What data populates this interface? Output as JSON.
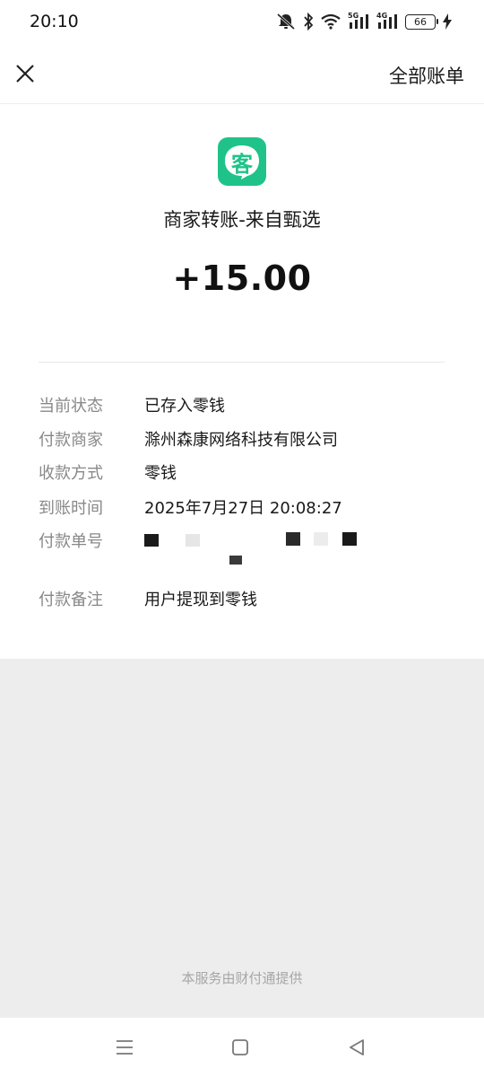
{
  "status_bar": {
    "time": "20:10",
    "battery": "66",
    "net_5g": "5G",
    "net_4g": "4G"
  },
  "header": {
    "close_icon": "close-icon",
    "all_bills_label": "全部账单"
  },
  "transaction": {
    "logo_char": "客",
    "logo_color": "#1fc389",
    "merchant_title": "商家转账-来自甄选",
    "amount": "+15.00"
  },
  "details": [
    {
      "label": "当前状态",
      "value": "已存入零钱"
    },
    {
      "label": "付款商家",
      "value": "滁州森康网络科技有限公司"
    },
    {
      "label": "收款方式",
      "value": "零钱"
    },
    {
      "label": "到账时间",
      "value": "2025年7月27日 20:08:27"
    },
    {
      "label": "付款单号",
      "value": ""
    },
    {
      "label": "付款备注",
      "value": "用户提现到零钱"
    }
  ],
  "footer": {
    "provider_text": "本服务由财付通提供"
  },
  "nav": {
    "menu_icon": "menu-icon",
    "home_icon": "home-icon",
    "back_icon": "back-icon"
  }
}
